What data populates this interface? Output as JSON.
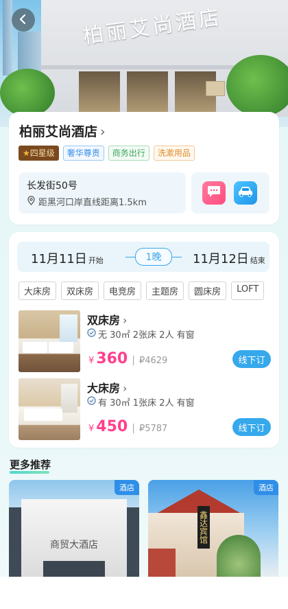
{
  "hero": {
    "sign_text": "柏丽艾尚酒店"
  },
  "hotel": {
    "name": "柏丽艾尚酒店",
    "tags": [
      "四星级",
      "奢华尊贵",
      "商务出行",
      "洗漱用品"
    ],
    "address": "长发街50号",
    "distance": "距黑河口岸直线距离1.5km"
  },
  "stay": {
    "checkin": "11月11日",
    "checkin_suffix": "开始",
    "checkout": "11月12日",
    "checkout_suffix": "结束",
    "nights": "1晚"
  },
  "room_types": [
    "大床房",
    "双床房",
    "电竞房",
    "主题房",
    "圆床房",
    "LOFT"
  ],
  "rooms": [
    {
      "name": "双床房",
      "desc": "无 30㎡ 2张床 2人 有窗",
      "currency": "¥",
      "price": "360",
      "orig_price": "₽4629",
      "book_label": "线下订"
    },
    {
      "name": "大床房",
      "desc": "有 30㎡ 1张床 2人 有窗",
      "currency": "¥",
      "price": "450",
      "orig_price": "₽5787",
      "book_label": "线下订"
    }
  ],
  "recommend": {
    "title": "更多推荐",
    "cards": [
      {
        "badge": "酒店",
        "sign": "商贸大酒店"
      },
      {
        "badge": "酒店",
        "sign": "鑫达宾馆"
      }
    ]
  },
  "colors": {
    "accent": "#36a8ec",
    "price": "#ff3f8e",
    "chat": "#ff5a8a",
    "car": "#2fa8f0"
  },
  "icons": {
    "back": "chevron-left-icon",
    "chat": "chat-icon",
    "taxi": "car-icon",
    "location": "location-pin-icon",
    "check": "check-circle-icon"
  }
}
